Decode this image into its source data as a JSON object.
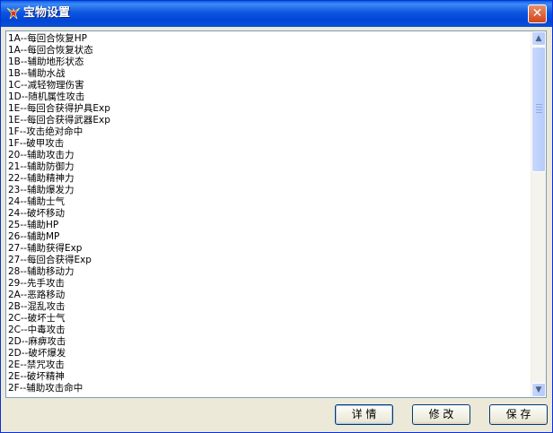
{
  "window": {
    "title": "宝物设置",
    "close_glyph": "✕"
  },
  "list": {
    "items": [
      "1A--每回合恢复HP",
      "1A--每回合恢复状态",
      "1B--辅助地形状态",
      "1B--辅助水战",
      "1C--减轻物理伤害",
      "1D--随机属性攻击",
      "1E--每回合获得护具Exp",
      "1E--每回合获得武器Exp",
      "1F--攻击绝对命中",
      "1F--破甲攻击",
      "20--辅助攻击力",
      "21--辅助防御力",
      "22--辅助精神力",
      "23--辅助爆发力",
      "24--辅助士气",
      "24--破坏移动",
      "25--辅助HP",
      "26--辅助MP",
      "27--辅助获得Exp",
      "27--每回合获得Exp",
      "28--辅助移动力",
      "29--先手攻击",
      "2A--恶路移动",
      "2B--混乱攻击",
      "2C--破坏士气",
      "2C--中毒攻击",
      "2D--麻痹攻击",
      "2D--破坏爆发",
      "2E--禁咒攻击",
      "2E--破坏精神",
      "2F--辅助攻击命中"
    ]
  },
  "buttons": {
    "details": "详 情",
    "modify": "修 改",
    "save": "保 存"
  },
  "colors": {
    "titlebar": "#0a4fd6",
    "close": "#d24418",
    "face": "#ece9d8"
  }
}
